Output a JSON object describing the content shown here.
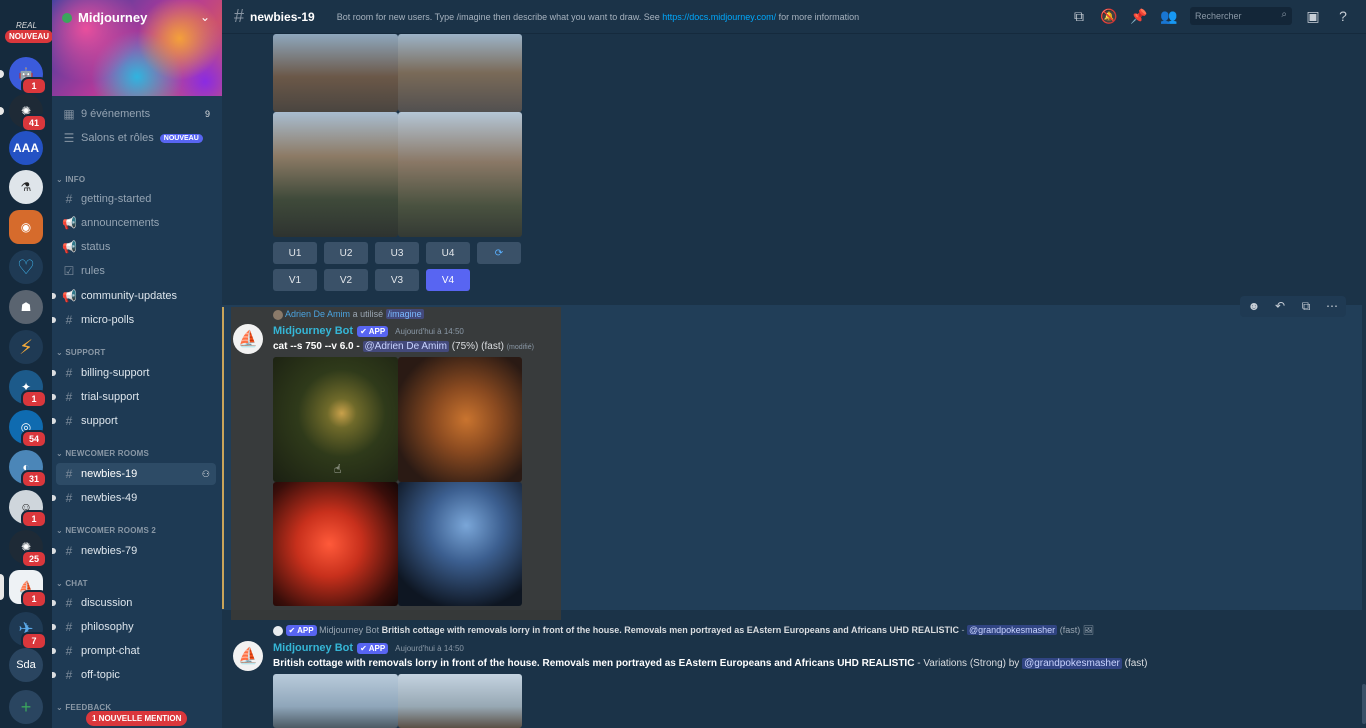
{
  "server": {
    "name": "Midjourney",
    "rail": [
      {
        "id": "real",
        "label": "REAL",
        "badge": "NOUVEAU"
      },
      {
        "id": "s1",
        "badge": "1"
      },
      {
        "id": "s2",
        "badge": "41"
      },
      {
        "id": "aaa",
        "label": "AAA"
      },
      {
        "id": "s4"
      },
      {
        "id": "s5"
      },
      {
        "id": "s6"
      },
      {
        "id": "s7"
      },
      {
        "id": "s8"
      },
      {
        "id": "s9",
        "badge": "1"
      },
      {
        "id": "s10",
        "badge": "54"
      },
      {
        "id": "s11",
        "badge": "31"
      },
      {
        "id": "s12",
        "badge": "1"
      },
      {
        "id": "s13",
        "badge": "25"
      },
      {
        "id": "s14",
        "badge": "1"
      },
      {
        "id": "s15",
        "badge": "7"
      },
      {
        "id": "sda",
        "label": "Sda"
      },
      {
        "id": "add",
        "label": "+"
      }
    ]
  },
  "sidebar": {
    "events": {
      "label": "9 événements",
      "count": "9"
    },
    "salons": {
      "label": "Salons et rôles",
      "tag": "NOUVEAU"
    },
    "categories": {
      "info": "INFO",
      "support": "SUPPORT",
      "newcomer": "NEWCOMER ROOMS",
      "newcomer2": "NEWCOMER ROOMS 2",
      "chat": "CHAT",
      "feedback": "FEEDBACK"
    },
    "channels": {
      "getting_started": "getting-started",
      "announcements": "announcements",
      "status": "status",
      "rules": "rules",
      "community_updates": "community-updates",
      "micro_polls": "micro-polls",
      "billing_support": "billing-support",
      "trial_support": "trial-support",
      "support": "support",
      "newbies_19": "newbies-19",
      "newbies_49": "newbies-49",
      "newbies_79": "newbies-79",
      "discussion": "discussion",
      "philosophy": "philosophy",
      "prompt_chat": "prompt-chat",
      "off_topic": "off-topic"
    },
    "mention_pill": "1 NOUVELLE MENTION"
  },
  "header": {
    "channel": "newbies-19",
    "topic_prefix": "Bot room for new users. Type /imagine then describe what you want to draw. See",
    "topic_link": "https://docs.midjourney.com/",
    "topic_suffix": "for more information",
    "search_placeholder": "Rechercher"
  },
  "buttons": {
    "u": [
      "U1",
      "U2",
      "U3",
      "U4"
    ],
    "v": [
      "V1",
      "V2",
      "V3",
      "V4"
    ]
  },
  "message1": {
    "reply_user": "Adrien De Amim",
    "reply_used": "a utilisé",
    "reply_cmd": "/imagine",
    "author": "Midjourney Bot",
    "app": "APP",
    "time": "Aujourd'hui à 14:50",
    "prompt": "cat --s 750 --v 6.0",
    "dash": "-",
    "mention": "@Adrien De Amim",
    "progress": "(75%) (fast)",
    "edited": "(modifié)"
  },
  "message2": {
    "reply_app": "APP",
    "reply_author": "Midjourney Bot",
    "reply_text": "British cottage with removals lorry in front of the house. Removals men portrayed as EAstern Europeans and Africans UHD REALISTIC",
    "reply_dash": "-",
    "reply_mention": "@grandpokesmasher",
    "reply_fast": "(fast)",
    "author": "Midjourney Bot",
    "app": "APP",
    "time": "Aujourd'hui à 14:50",
    "prompt": "British cottage with removals lorry in front of the house. Removals men portrayed as EAstern Europeans and Africans UHD REALISTIC",
    "suffix": "- Variations (Strong) by",
    "mention": "@grandpokesmasher",
    "fast": "(fast)"
  }
}
